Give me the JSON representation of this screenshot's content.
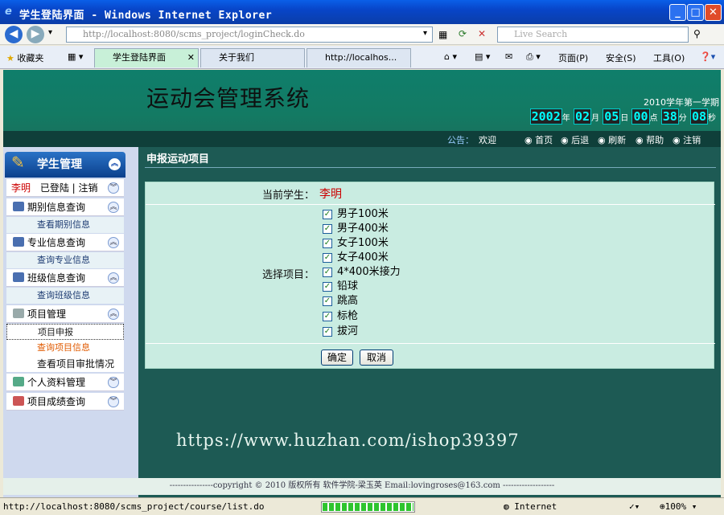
{
  "browser": {
    "title": "学生登陆界面 - Windows Internet Explorer",
    "url": "http://localhost:8080/scms_project/loginCheck.do",
    "search_placeholder": "Live Search",
    "favorites": "收藏夹",
    "tabs": [
      {
        "label": "学生登陆界面"
      },
      {
        "label": "关于我们"
      },
      {
        "label": "http://localhos..."
      }
    ],
    "toolbar": {
      "page": "页面(P)",
      "safety": "安全(S)",
      "tools": "工具(O)"
    },
    "status_url": "http://localhost:8080/scms_project/course/list.do",
    "zone": "Internet",
    "zoom": "100%",
    "progress": 1.0
  },
  "site": {
    "system_name": "运动会管理系统",
    "term": "2010学年第一学期",
    "clock": {
      "y": "2002",
      "m": "02",
      "d": "05",
      "h": "00",
      "mi": "38",
      "s": "08",
      "ylbl": "年",
      "mlbl": "月",
      "dlbl": "日",
      "hlbl": "点",
      "milbl": "分",
      "slbl": "秒"
    },
    "notice_label": "公告：",
    "notice_text": "欢迎",
    "links": [
      "首页",
      "后退",
      "刷新",
      "帮助",
      "注销"
    ]
  },
  "sidebar": {
    "title": "学生管理",
    "user": "李明",
    "logged": "已登陆",
    "logout": "注销",
    "groups": [
      {
        "label": "期别信息查询",
        "items": [
          "查看期别信息"
        ]
      },
      {
        "label": "专业信息查询",
        "items": [
          "查询专业信息"
        ]
      },
      {
        "label": "班级信息查询",
        "items": [
          "查询班级信息"
        ]
      },
      {
        "label": "项目管理",
        "items": [
          "项目申报",
          "查询项目信息",
          "查看项目审批情况"
        ]
      },
      {
        "label": "个人资料管理",
        "items": []
      },
      {
        "label": "项目成绩查询",
        "items": []
      }
    ]
  },
  "main": {
    "title": "申报运动项目",
    "current_label": "当前学生：",
    "current_value": "李明",
    "select_label": "选择项目：",
    "options": [
      "男子100米",
      "男子400米",
      "女子100米",
      "女子400米",
      "4*400米接力",
      "铅球",
      "跳高",
      "标枪",
      "拔河"
    ],
    "ok": "确定",
    "cancel": "取消"
  },
  "watermark": "https://www.huzhan.com/ishop39397",
  "footer": "----------------copyright © 2010 版权所有 软件学院-梁玉英 Email:lovingroses@163.com -------------------"
}
